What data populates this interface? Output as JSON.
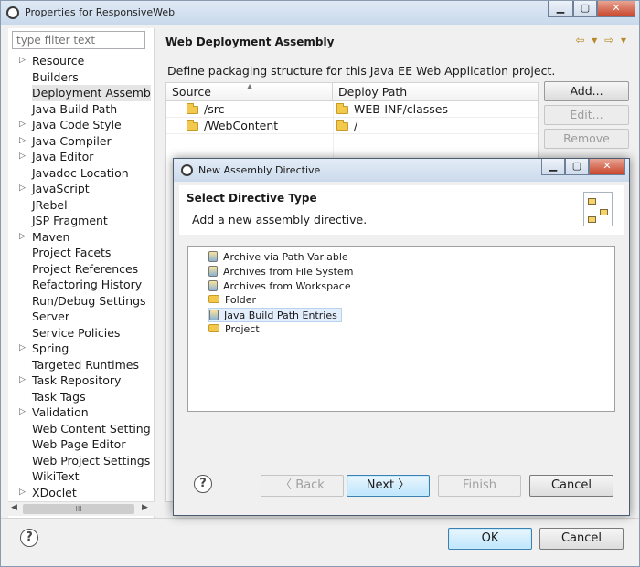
{
  "window": {
    "title": "Properties for ResponsiveWeb",
    "min": "▁",
    "max": "▢",
    "close": "✕"
  },
  "left": {
    "filter_placeholder": "type filter text",
    "items": [
      {
        "label": "Resource",
        "expandable": true
      },
      {
        "label": "Builders",
        "expandable": false
      },
      {
        "label": "Deployment Assemb",
        "expandable": false,
        "selected": true
      },
      {
        "label": "Java Build Path",
        "expandable": false
      },
      {
        "label": "Java Code Style",
        "expandable": true
      },
      {
        "label": "Java Compiler",
        "expandable": true
      },
      {
        "label": "Java Editor",
        "expandable": true
      },
      {
        "label": "Javadoc Location",
        "expandable": false
      },
      {
        "label": "JavaScript",
        "expandable": true
      },
      {
        "label": "JRebel",
        "expandable": false
      },
      {
        "label": "JSP Fragment",
        "expandable": false
      },
      {
        "label": "Maven",
        "expandable": true
      },
      {
        "label": "Project Facets",
        "expandable": false
      },
      {
        "label": "Project References",
        "expandable": false
      },
      {
        "label": "Refactoring History",
        "expandable": false
      },
      {
        "label": "Run/Debug Settings",
        "expandable": false
      },
      {
        "label": "Server",
        "expandable": false
      },
      {
        "label": "Service Policies",
        "expandable": false
      },
      {
        "label": "Spring",
        "expandable": true
      },
      {
        "label": "Targeted Runtimes",
        "expandable": false
      },
      {
        "label": "Task Repository",
        "expandable": true
      },
      {
        "label": "Task Tags",
        "expandable": false
      },
      {
        "label": "Validation",
        "expandable": true
      },
      {
        "label": "Web Content Setting",
        "expandable": false
      },
      {
        "label": "Web Page Editor",
        "expandable": false
      },
      {
        "label": "Web Project Settings",
        "expandable": false
      },
      {
        "label": "WikiText",
        "expandable": false
      },
      {
        "label": "XDoclet",
        "expandable": true
      }
    ],
    "scroll_thumb": "III"
  },
  "page": {
    "title": "Web Deployment Assembly",
    "nav": "⇦ ▾ ⇨ ▾",
    "description": "Define packaging structure for this Java EE Web Application project.",
    "columns": [
      "Source",
      "Deploy Path"
    ],
    "rows": [
      {
        "source": "/src",
        "deploy": "WEB-INF/classes"
      },
      {
        "source": "/WebContent",
        "deploy": "/"
      }
    ],
    "add": "Add...",
    "edit": "Edit...",
    "remove": "Remove"
  },
  "dialog": {
    "title": "New Assembly Directive",
    "heading": "Select Directive Type",
    "subheading": "Add a new assembly directive.",
    "items": [
      {
        "label": "Archive via Path Variable",
        "icon": "jar-icon"
      },
      {
        "label": "Archives from File System",
        "icon": "jar-icon"
      },
      {
        "label": "Archives from Workspace",
        "icon": "jar-icon"
      },
      {
        "label": "Folder",
        "icon": "folder-icon"
      },
      {
        "label": "Java Build Path Entries",
        "icon": "library-icon",
        "selected": true
      },
      {
        "label": "Project",
        "icon": "project-icon"
      }
    ],
    "back": "〈 Back",
    "next": "Next 〉",
    "finish": "Finish",
    "cancel": "Cancel"
  },
  "footer": {
    "ok": "OK",
    "cancel": "Cancel"
  },
  "colors": {
    "selection": "#e2eefb",
    "primary_button": "#bee6fd",
    "folder": "#f2c94c"
  }
}
